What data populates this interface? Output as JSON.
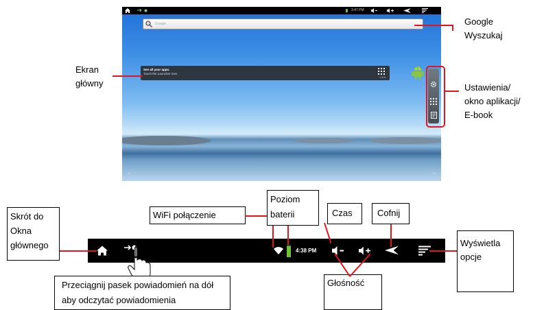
{
  "screen": {
    "status_time": "3:47 PM",
    "search_placeholder": "Google",
    "widget_line1": "See all your apps.",
    "widget_line2": "Touch the Launcher icon.",
    "widget_page": "1 of 5",
    "dots_left": "••",
    "dots_right": "••"
  },
  "callouts": {
    "google_search": "Google Wyszukaj",
    "home_screen": "Ekran główny",
    "settings_apps_ebook": "Ustawienia/ okno aplikacji/ E-book",
    "home_shortcut": "Skrót do Okna głównego",
    "wifi": "WiFi połączenie",
    "battery": "Poziom baterii",
    "time": "Czas",
    "back": "Cofnij",
    "options": "Wyświetla opcje",
    "drag_notifications": "Przeciągnij pasek powiadomień na dół aby odczytać powiadomienia",
    "volume": "Głośność"
  },
  "bar": {
    "time": "4:38 PM"
  },
  "colors": {
    "callout_red": "#e3141b",
    "bar_black": "#000000",
    "battery_green": "#6fc23a"
  }
}
